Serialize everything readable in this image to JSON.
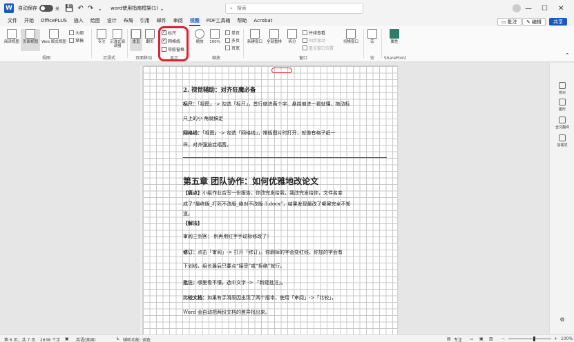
{
  "titlebar": {
    "autosave_label": "自动保存",
    "autosave_state": "关",
    "doc_title": "word使用指南框架(1)",
    "search_placeholder": "搜索",
    "minimize": "—",
    "maximize": "☐",
    "close": "✕"
  },
  "menu": {
    "tabs": [
      "文件",
      "开始",
      "OfficePLUS",
      "插入",
      "绘图",
      "设计",
      "布局",
      "引用",
      "邮件",
      "审阅",
      "视图",
      "PDF工具箱",
      "帮助",
      "Acrobat"
    ],
    "active_index": 10,
    "comment_btn": "批注",
    "edit_btn": "编辑",
    "share_btn": "共享"
  },
  "ribbon": {
    "view_group": {
      "label": "视图",
      "read_mode": "阅读视图",
      "print_layout": "页面视图",
      "web_layout": "Web 版式视图",
      "outline": "大纲",
      "draft": "草稿"
    },
    "immersive_group": {
      "label": "沉浸式",
      "focus": "专注",
      "immersive_reader": "沉浸式阅读器"
    },
    "page_move_group": {
      "label": "页面移动",
      "vertical": "垂直",
      "side_by_side": "翻页"
    },
    "show_group": {
      "label": "显示",
      "ruler": "标尺",
      "gridlines": "网格线",
      "nav_pane": "导航窗格"
    },
    "zoom_group": {
      "label": "缩放",
      "zoom": "缩放",
      "percent": "100%",
      "one_page": "单页",
      "multi_page": "多页",
      "page_width": "页宽"
    },
    "window_group": {
      "label": "窗口",
      "new_window": "新建窗口",
      "arrange_all": "全部重排",
      "split": "拆分",
      "side_by_side": "并排查看",
      "sync_scroll": "同步滚动",
      "reset_pos": "重设窗口位置",
      "switch_window": "切换窗口"
    },
    "macros_group": {
      "label": "宏",
      "macros": "宏"
    },
    "sharepoint_group": {
      "label": "SharePoint",
      "properties": "属性"
    }
  },
  "document": {
    "section_heading": "2. 视觉辅助：对齐狂魔必备",
    "p1_bold": "标尺：",
    "p1_a": "「视图」-> 勾选「标尺」，首行缩进两个字、悬挂缩进一看就懂，拖动标",
    "p1_b": "尺上的小   角就搞定",
    "p2_bold": "网格线：",
    "p2_a": "「视图」-> 勾选「网格线」，排版图片时打开，就像有格子纸一",
    "p2_b": "样，对齐强迫症福音。",
    "chapter": "第五章 团队协作：如何优雅地改论文",
    "pain_label": "【痛点】",
    "pain_a": "小组作业合写一份报告，你改完发给我，我改完发给你，文件名变",
    "pain_b": "成了“最终版_打死不改版_绝对不改版 3.docx”，结果发现最改了哪里完全不知",
    "pain_c": "道。",
    "solve_label": "【解法】",
    "review_line": "审阅三剑客：  别再用红字手动标修改了！",
    "rev_bold": "修订：",
    "rev_a": "点击「审阅」-> 打开「修订」。你删掉的字会变红线，你加的字会有",
    "rev_b": "下划线，组长最后只要点“接受”或“拒绝”就行。",
    "cmt_bold": "批注：",
    "cmt_a": "哪里看不懂，选中文字 -> 「新建批注」。",
    "cmp_bold": "比较文档：",
    "cmp_a": "如果有手滑原因出现了两个版本，使用「审阅」->「比较」，",
    "cmp_b": "Word 会自动把两份文档的差异找出来。"
  },
  "rightpane": {
    "editor": "校对",
    "draw": "图形",
    "translate": "全文翻译",
    "addins": "加载项"
  },
  "status": {
    "page": "第 6 页，共 7 页",
    "words": "2638 个字",
    "lang": "英语(美国)",
    "accessibility": "辅助功能: 调查",
    "focus": "专注",
    "zoom": "100%"
  }
}
